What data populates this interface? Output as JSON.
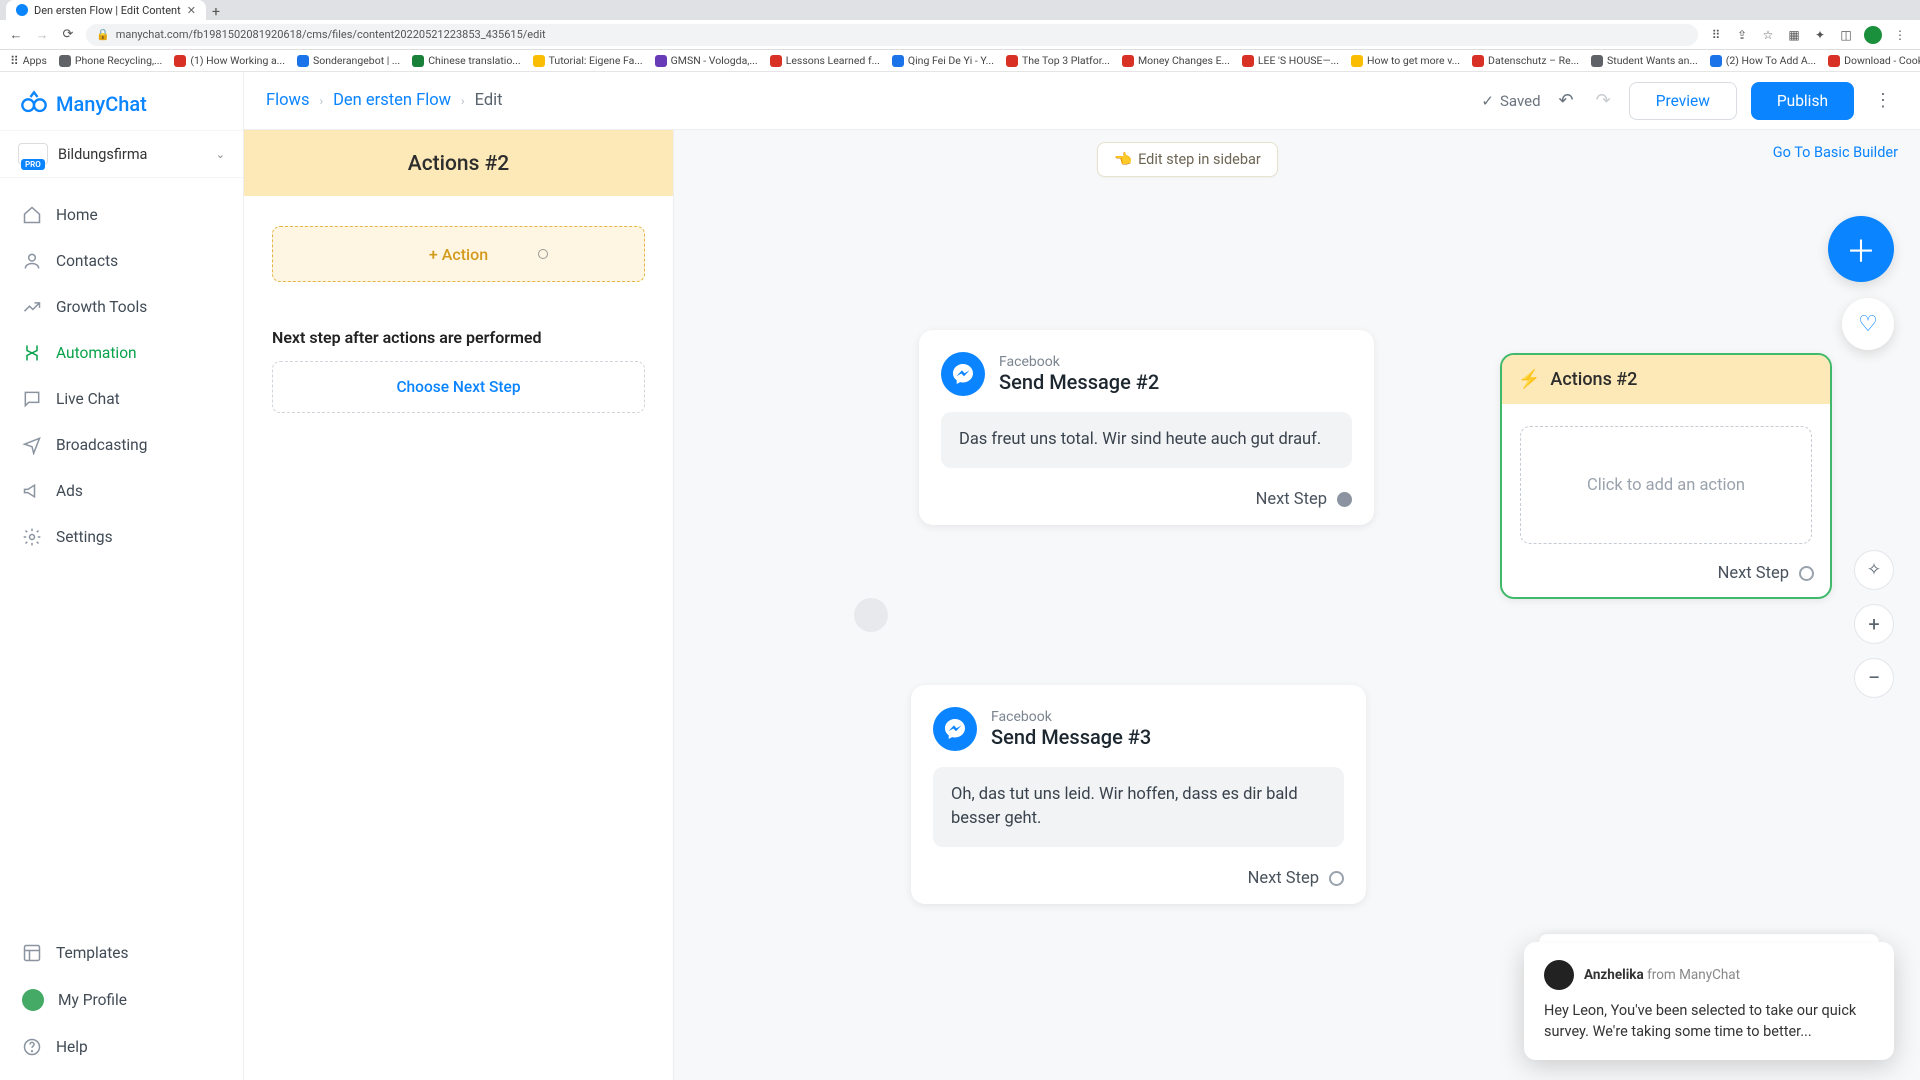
{
  "browser": {
    "tab_title": "Den ersten Flow | Edit Content",
    "url": "manychat.com/fb198150208192061​8/cms/files/content20220521223853_435615/edit",
    "bookmarks": [
      "Apps",
      "Phone Recycling,...",
      "(1) How Working a...",
      "Sonderangebot | ...",
      "Chinese translatio...",
      "Tutorial: Eigene Fa...",
      "GMSN - Vologda,...",
      "Lessons Learned f...",
      "Qing Fei De Yi - Y...",
      "The Top 3 Platfor...",
      "Money Changes E...",
      "LEE 'S HOUSE—...",
      "How to get more v...",
      "Datenschutz – Re...",
      "Student Wants an...",
      "(2) How To Add A...",
      "Download - Cooki..."
    ]
  },
  "app": {
    "brand": "ManyChat",
    "org": {
      "name": "Bildungsfirma",
      "badge": "PRO"
    },
    "nav": {
      "home": "Home",
      "contacts": "Contacts",
      "growth": "Growth Tools",
      "automation": "Automation",
      "livechat": "Live Chat",
      "broadcasting": "Broadcasting",
      "ads": "Ads",
      "settings": "Settings",
      "templates": "Templates",
      "profile": "My Profile",
      "help": "Help"
    },
    "topbar": {
      "crumb_flows": "Flows",
      "crumb_flow": "Den ersten Flow",
      "crumb_edit": "Edit",
      "saved": "Saved",
      "preview": "Preview",
      "publish": "Publish"
    },
    "editpanel": {
      "title": "Actions #2",
      "add_action": "+ Action",
      "next_step_heading": "Next step after actions are performed",
      "choose_next": "Choose Next Step"
    },
    "canvas": {
      "edit_sidebar": "Edit step in sidebar",
      "basic_builder": "Go To Basic Builder",
      "next_step_label": "Next Step",
      "msg2": {
        "platform": "Facebook",
        "title": "Send Message #2",
        "text": "Das freut uns total. Wir sind heute auch gut drauf."
      },
      "msg3": {
        "platform": "Facebook",
        "title": "Send Message #3",
        "text": "Oh, das tut uns leid. Wir hoffen, dass es dir bald besser geht."
      },
      "actions_node": {
        "title": "Actions #2",
        "placeholder": "Click to add an action"
      }
    },
    "chat": {
      "author": "Anzhelika",
      "from": "from ManyChat",
      "body": "Hey Leon,  You've been selected to take our quick survey. We're taking some time to better..."
    }
  }
}
